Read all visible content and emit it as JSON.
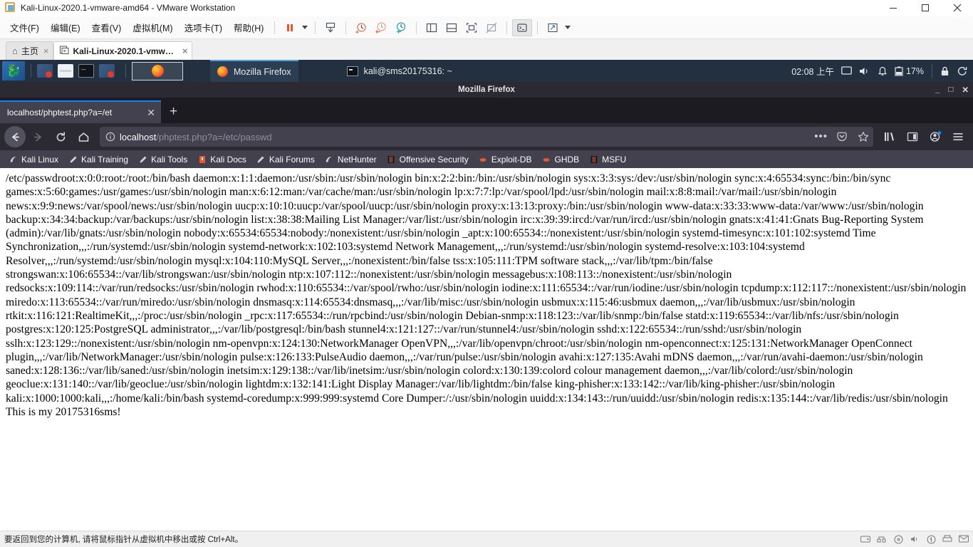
{
  "vmware": {
    "title": "Kali-Linux-2020.1-vmware-amd64 - VMware Workstation",
    "window_buttons": {
      "minimize": "minimize-icon",
      "maximize": "maximize-icon",
      "close": "close-icon"
    },
    "menus": [
      "文件(F)",
      "编辑(E)",
      "查看(V)",
      "虚拟机(M)",
      "选项卡(T)",
      "帮助(H)"
    ],
    "toolbar_icons": [
      "pause-icon",
      "dropdown-caret-icon",
      "snapshot-manager-icon",
      "take-snapshot-icon",
      "revert-snapshot-icon",
      "manage-snapshots-icon",
      "show-sidebar-icon",
      "show-console-icon",
      "full-screen-icon",
      "stretch-guest-icon",
      "unity-mode-icon",
      "expand-icon",
      "expand-caret-icon"
    ],
    "tabs": [
      {
        "label": "主页",
        "icon": "home-icon",
        "selected": false,
        "close": "×"
      },
      {
        "label": "Kali-Linux-2020.1-vmwar...",
        "icon": "vm-icon",
        "selected": true,
        "close": "×"
      }
    ],
    "status_text": "要返回到您的计算机, 请将鼠标指针从虚拟机中移出或按 Ctrl+Alt。",
    "status_icons": [
      "hdd-icon",
      "network-icon",
      "cd-icon",
      "sound-icon",
      "usb-icon",
      "printer-icon",
      "message-icon"
    ]
  },
  "kali_panel": {
    "logo": "kali-dragon-icon",
    "launchers": [
      "firefox-launcher-icon",
      "files-launcher-icon",
      "terminal-launcher-icon",
      "screenshot-launcher-icon"
    ],
    "workspace_icon": "firefox-workspace-icon",
    "tasks": [
      {
        "label": "Mozilla Firefox",
        "icon": "firefox-icon",
        "active": true
      },
      {
        "label": "kali@sms20175316: ~",
        "icon": "terminal-icon",
        "active": false
      }
    ],
    "clock": "02:08 上午",
    "tray": {
      "display": "display-icon",
      "volume": "volume-icon",
      "notifications": "bell-icon",
      "battery_icon": "battery-icon",
      "battery": "17%",
      "lock": "lock-icon",
      "logout": "logout-icon"
    }
  },
  "firefox": {
    "window_title": "Mozilla Firefox",
    "window_buttons": {
      "minimize": "_",
      "maximize": "□",
      "close": "✕"
    },
    "tabs": [
      {
        "title": "localhost/phptest.php?a=/et",
        "close": "✕",
        "active": true
      }
    ],
    "new_tab": "+",
    "nav": {
      "back": "back-arrow-icon",
      "forward": "forward-arrow-icon",
      "reload": "reload-icon",
      "home": "home-icon"
    },
    "urlbar": {
      "identity_icon": "info-circle-icon",
      "host": "localhost",
      "path": "/phptest.php?a=/etc/passwd",
      "full_url": "localhost/phptest.php?a=/etc/passwd",
      "page_actions": "ellipsis-icon",
      "pocket": "pocket-icon",
      "bookmark": "star-icon"
    },
    "toolbar_right": {
      "library": "library-icon",
      "sidebar": "sidebar-icon",
      "account": "account-icon",
      "menu": "hamburger-menu-icon"
    },
    "bookmarks": [
      {
        "label": "Kali Linux",
        "icon": "kali-dragon-bookmark-icon"
      },
      {
        "label": "Kali Training",
        "icon": "wrench-icon"
      },
      {
        "label": "Kali Tools",
        "icon": "wrench-icon"
      },
      {
        "label": "Kali Docs",
        "icon": "book-icon"
      },
      {
        "label": "Kali Forums",
        "icon": "wrench-icon"
      },
      {
        "label": "NetHunter",
        "icon": "kali-dragon-bookmark-icon"
      },
      {
        "label": "Offensive Security",
        "icon": "offsec-icon"
      },
      {
        "label": "Exploit-DB",
        "icon": "exploit-db-icon"
      },
      {
        "label": "GHDB",
        "icon": "exploit-db-icon"
      },
      {
        "label": "MSFU",
        "icon": "offsec-icon"
      }
    ]
  },
  "page": {
    "body_text": "/etc/passwdroot:x:0:0:root:/root:/bin/bash daemon:x:1:1:daemon:/usr/sbin:/usr/sbin/nologin bin:x:2:2:bin:/bin:/usr/sbin/nologin sys:x:3:3:sys:/dev:/usr/sbin/nologin sync:x:4:65534:sync:/bin:/bin/sync games:x:5:60:games:/usr/games:/usr/sbin/nologin man:x:6:12:man:/var/cache/man:/usr/sbin/nologin lp:x:7:7:lp:/var/spool/lpd:/usr/sbin/nologin mail:x:8:8:mail:/var/mail:/usr/sbin/nologin news:x:9:9:news:/var/spool/news:/usr/sbin/nologin uucp:x:10:10:uucp:/var/spool/uucp:/usr/sbin/nologin proxy:x:13:13:proxy:/bin:/usr/sbin/nologin www-data:x:33:33:www-data:/var/www:/usr/sbin/nologin backup:x:34:34:backup:/var/backups:/usr/sbin/nologin list:x:38:38:Mailing List Manager:/var/list:/usr/sbin/nologin irc:x:39:39:ircd:/var/run/ircd:/usr/sbin/nologin gnats:x:41:41:Gnats Bug-Reporting System (admin):/var/lib/gnats:/usr/sbin/nologin nobody:x:65534:65534:nobody:/nonexistent:/usr/sbin/nologin _apt:x:100:65534::/nonexistent:/usr/sbin/nologin systemd-timesync:x:101:102:systemd Time Synchronization,,,:/run/systemd:/usr/sbin/nologin systemd-network:x:102:103:systemd Network Management,,,:/run/systemd:/usr/sbin/nologin systemd-resolve:x:103:104:systemd Resolver,,,:/run/systemd:/usr/sbin/nologin mysql:x:104:110:MySQL Server,,,:/nonexistent:/bin/false tss:x:105:111:TPM software stack,,,:/var/lib/tpm:/bin/false strongswan:x:106:65534::/var/lib/strongswan:/usr/sbin/nologin ntp:x:107:112::/nonexistent:/usr/sbin/nologin messagebus:x:108:113::/nonexistent:/usr/sbin/nologin redsocks:x:109:114::/var/run/redsocks:/usr/sbin/nologin rwhod:x:110:65534::/var/spool/rwho:/usr/sbin/nologin iodine:x:111:65534::/var/run/iodine:/usr/sbin/nologin tcpdump:x:112:117::/nonexistent:/usr/sbin/nologin miredo:x:113:65534::/var/run/miredo:/usr/sbin/nologin dnsmasq:x:114:65534:dnsmasq,,,:/var/lib/misc:/usr/sbin/nologin usbmux:x:115:46:usbmux daemon,,,:/var/lib/usbmux:/usr/sbin/nologin rtkit:x:116:121:RealtimeKit,,,:/proc:/usr/sbin/nologin _rpc:x:117:65534::/run/rpcbind:/usr/sbin/nologin Debian-snmp:x:118:123::/var/lib/snmp:/bin/false statd:x:119:65534::/var/lib/nfs:/usr/sbin/nologin postgres:x:120:125:PostgreSQL administrator,,,:/var/lib/postgresql:/bin/bash stunnel4:x:121:127::/var/run/stunnel4:/usr/sbin/nologin sshd:x:122:65534::/run/sshd:/usr/sbin/nologin sslh:x:123:129::/nonexistent:/usr/sbin/nologin nm-openvpn:x:124:130:NetworkManager OpenVPN,,,:/var/lib/openvpn/chroot:/usr/sbin/nologin nm-openconnect:x:125:131:NetworkManager OpenConnect plugin,,,:/var/lib/NetworkManager:/usr/sbin/nologin pulse:x:126:133:PulseAudio daemon,,,:/var/run/pulse:/usr/sbin/nologin avahi:x:127:135:Avahi mDNS daemon,,,:/var/run/avahi-daemon:/usr/sbin/nologin saned:x:128:136::/var/lib/saned:/usr/sbin/nologin inetsim:x:129:138::/var/lib/inetsim:/usr/sbin/nologin colord:x:130:139:colord colour management daemon,,,:/var/lib/colord:/usr/sbin/nologin geoclue:x:131:140::/var/lib/geoclue:/usr/sbin/nologin lightdm:x:132:141:Light Display Manager:/var/lib/lightdm:/bin/false king-phisher:x:133:142::/var/lib/king-phisher:/usr/sbin/nologin kali:x:1000:1000:kali,,,:/home/kali:/bin/bash systemd-coredump:x:999:999:systemd Core Dumper:/:/usr/sbin/nologin uuidd:x:134:143::/run/uuidd:/usr/sbin/nologin redis:x:135:144::/var/lib/redis:/usr/sbin/nologin This is my 20175316sms!"
  },
  "colors": {
    "kali_panel_bg": "#22303f",
    "firefox_chrome": "#2b2a33",
    "firefox_tabbar": "#1c1b22",
    "accent_blue": "#0a84ff",
    "bookmark_bar": "#42414d"
  }
}
